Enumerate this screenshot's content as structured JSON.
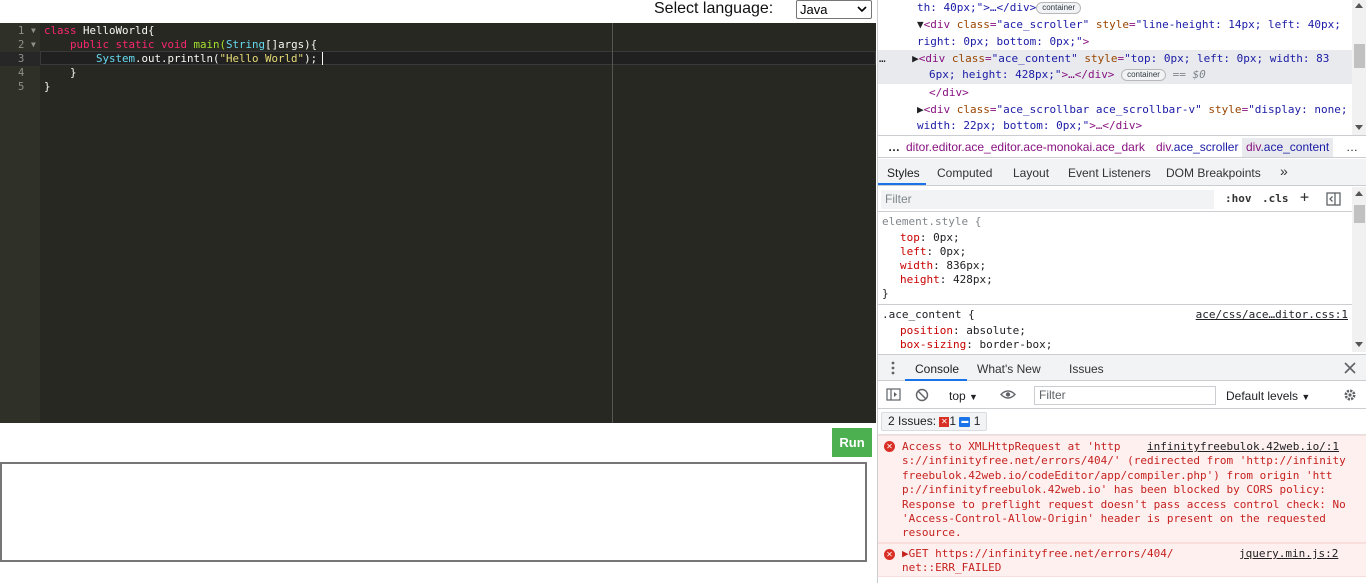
{
  "header": {
    "language_label": "Select language:",
    "language_value": "Java"
  },
  "editor": {
    "line_numbers": [
      "1",
      "2",
      "3",
      "4",
      "5"
    ],
    "theme_colors": {
      "background": "#272822",
      "gutter": "#2f3129",
      "keyword": "#f92672",
      "string": "#e6db74",
      "type": "#66d9ef"
    },
    "lines": [
      {
        "kw": "class",
        "rest": " HelloWorld{"
      },
      {
        "indent": "    ",
        "kw": "public static void",
        "name": " main(",
        "type": "String",
        "rest": "[]args){"
      },
      {
        "indent": "        ",
        "obj": "System",
        "rest": ".out.println(",
        "str": "\"Hello World\"",
        "end": ");"
      },
      {
        "text": "    }"
      },
      {
        "text": "}"
      }
    ]
  },
  "run_button": {
    "label": "Run",
    "color": "#4caf50"
  },
  "output_box": {
    "value": ""
  },
  "devtools": {
    "elements": {
      "line0_text": "th: 40px;\">…</div>",
      "line0_badge": "container",
      "line1_tag_open": "<div ",
      "line1_attr": "class",
      "line1_val": "\"ace_scroller\"",
      "line1_attr2": " style",
      "line1_val2": "\"line-height: 14px; left: 40px;",
      "line2_val": "right: 0px; bottom: 0px;\"",
      "line2_end": ">",
      "line3_dots": "…",
      "line3_tag": "<div ",
      "line3_attr": "class",
      "line3_val": "\"ace_content\"",
      "line3_attr2": " style",
      "line3_val2": "\"top: 0px; left: 0px; width: 83",
      "line4_val": "6px; height: 428px;\"",
      "line4_end": ">…</div>",
      "line4_badge": "container",
      "line4_eq": "== $0",
      "line5_text": "</div>",
      "line6_tag": "<div ",
      "line6_attr": "class",
      "line6_val": "\"ace_scrollbar ace_scrollbar-v\"",
      "line6_attr2": " style",
      "line6_val2": "\"display: none;",
      "line7_val": "width: 22px; bottom: 0px;\"",
      "line7_end": ">…</div>"
    },
    "breadcrumb": {
      "lead": "…",
      "item1": "ditor.editor.ace_editor.ace-monokai.ace_dark",
      "item2_tag": "div",
      "item2_cls": ".ace_scroller",
      "item3_tag": "div",
      "item3_cls": ".ace_content",
      "trail": "…"
    },
    "styles_tabs": [
      "Styles",
      "Computed",
      "Layout",
      "Event Listeners",
      "DOM Breakpoints",
      "»"
    ],
    "styles_filter_placeholder": "Filter",
    "hov": ":hov",
    "cls": ".cls",
    "plus": "+",
    "element_style": {
      "selector": "element.style {",
      "props": [
        {
          "name": "top",
          "value": "0px;"
        },
        {
          "name": "left",
          "value": "0px;"
        },
        {
          "name": "width",
          "value": "836px;"
        },
        {
          "name": "height",
          "value": "428px;"
        }
      ],
      "close": "}"
    },
    "ace_content_rule": {
      "selector": ".ace_content {",
      "source": "ace/css/ace…ditor.css:1",
      "props": [
        {
          "name": "position",
          "value": "absolute;"
        },
        {
          "name": "box-sizing",
          "value": "border-box;"
        }
      ]
    },
    "drawer_tabs": [
      "Console",
      "What's New",
      "Issues"
    ],
    "console": {
      "context": "top",
      "filter_placeholder": "Filter",
      "levels": "Default levels",
      "issues_label": "2 Issues:",
      "issues_errors": "1",
      "issues_messages": "1"
    },
    "messages": [
      {
        "lines": [
          "Access to XMLHttpRequest at 'http",
          "s://infinityfree.net/errors/404/' (redirected from 'http://infinity",
          "freebulok.42web.io/codeEditor/app/compiler.php') from origin 'htt",
          "p://infinityfreebulok.42web.io' has been blocked by CORS policy:",
          "Response to preflight request doesn't pass access control check: No",
          "'Access-Control-Allow-Origin' header is present on the requested",
          "resource."
        ],
        "source": "infinityfreebulok.42web.io/:1"
      },
      {
        "lines": [
          "▶GET https://infinityfree.net/errors/404/",
          "net::ERR_FAILED"
        ],
        "source": "jquery.min.js:2"
      }
    ]
  }
}
